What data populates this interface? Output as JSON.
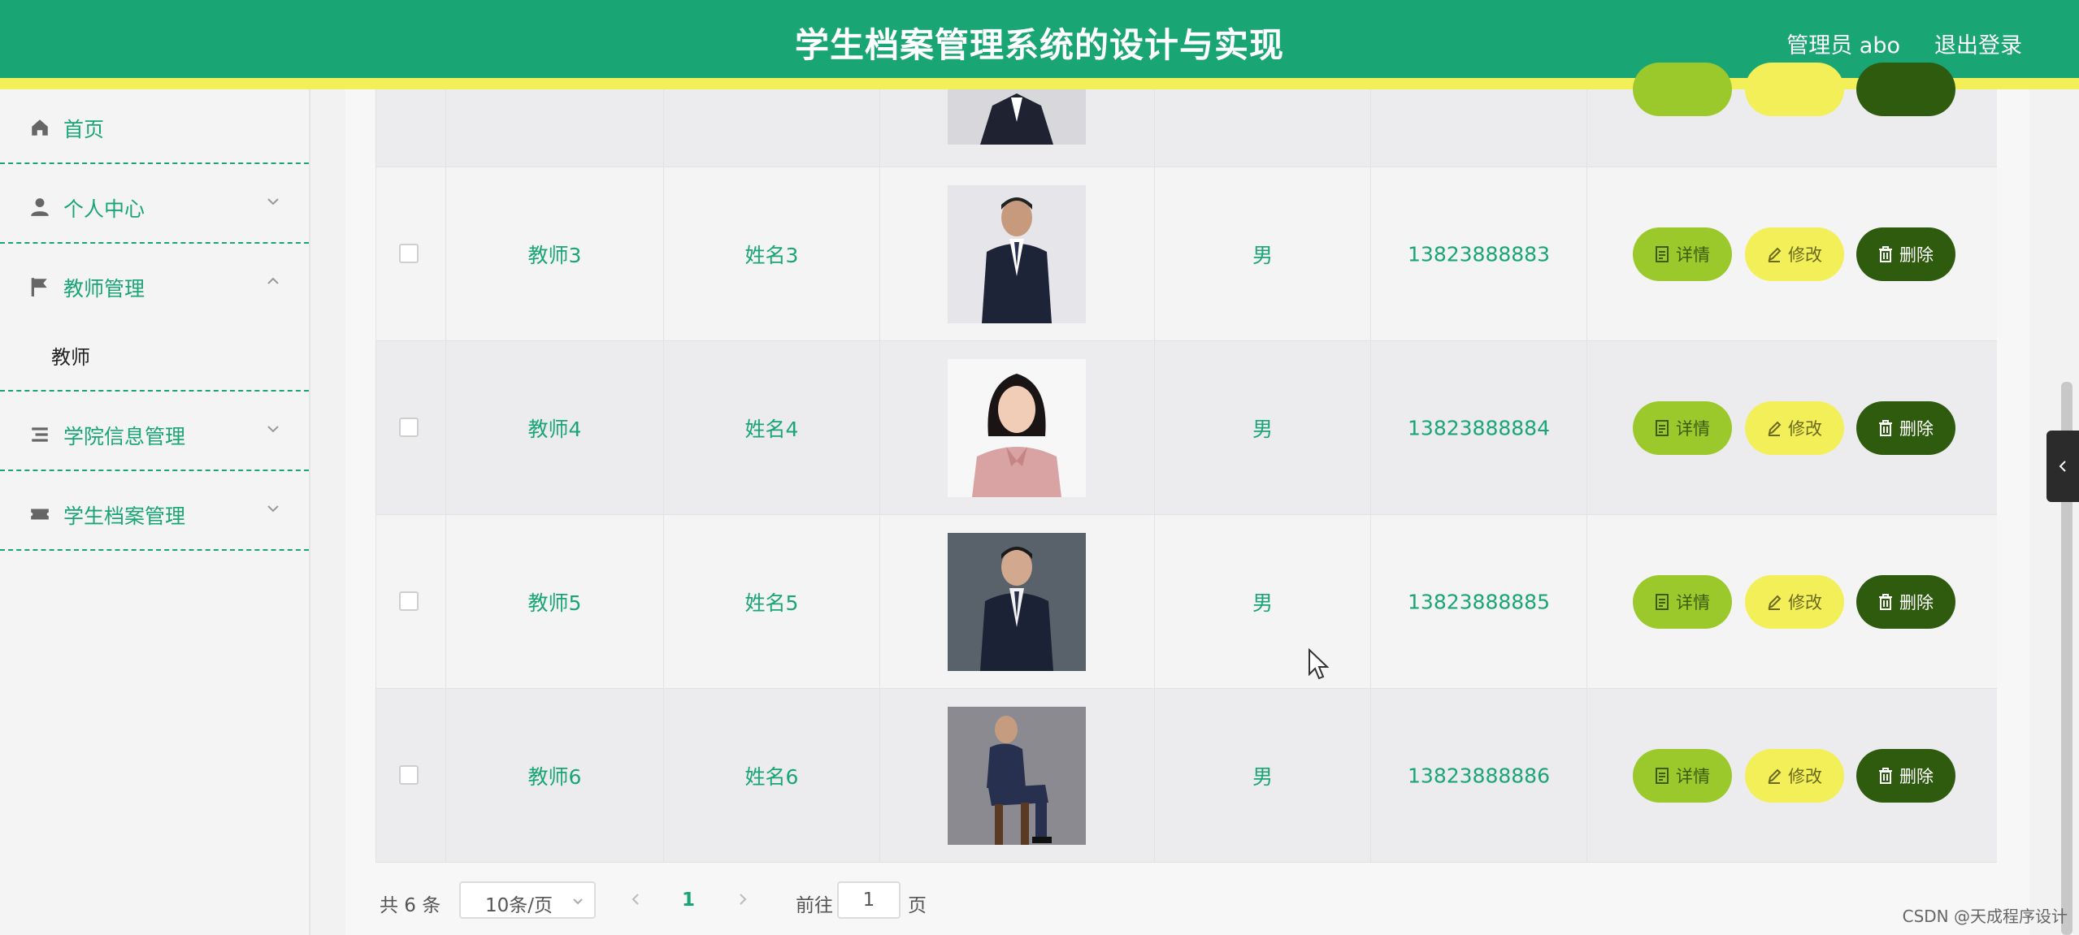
{
  "header": {
    "title": "学生档案管理系统的设计与实现",
    "user": "管理员 abo",
    "logout": "退出登录"
  },
  "sidebar": {
    "items": [
      {
        "label": "首页",
        "icon": "home-icon"
      },
      {
        "label": "个人中心",
        "icon": "person-icon",
        "expanded": false
      },
      {
        "label": "教师管理",
        "icon": "flag-icon",
        "expanded": true,
        "children": [
          "教师"
        ]
      },
      {
        "label": "学院信息管理",
        "icon": "list-icon",
        "expanded": false
      },
      {
        "label": "学生档案管理",
        "icon": "ticket-icon",
        "expanded": false
      }
    ]
  },
  "table": {
    "rows": [
      {
        "id": "教师3",
        "name": "姓名3",
        "gender": "男",
        "phone": "13823888883",
        "photo": "man-suit-photo"
      },
      {
        "id": "教师4",
        "name": "姓名4",
        "gender": "男",
        "phone": "13823888884",
        "photo": "woman-pink-blouse-photo"
      },
      {
        "id": "教师5",
        "name": "姓名5",
        "gender": "男",
        "phone": "13823888885",
        "photo": "man-suit-photo"
      },
      {
        "id": "教师6",
        "name": "姓名6",
        "gender": "男",
        "phone": "13823888886",
        "photo": "man-seated-photo"
      }
    ],
    "actions": {
      "detail": "详情",
      "edit": "修改",
      "delete": "删除"
    }
  },
  "pagination": {
    "total": "共 6 条",
    "page_size": "10条/页",
    "current_page": "1",
    "goto_label": "前往",
    "goto_value": "1",
    "page_suffix": "页"
  },
  "watermark": "CSDN @天成程序设计",
  "colors": {
    "primary": "#1aa575",
    "accent_yellow": "#f2ef58",
    "detail_btn": "#9bc92c",
    "delete_btn": "#2e5b0e"
  }
}
